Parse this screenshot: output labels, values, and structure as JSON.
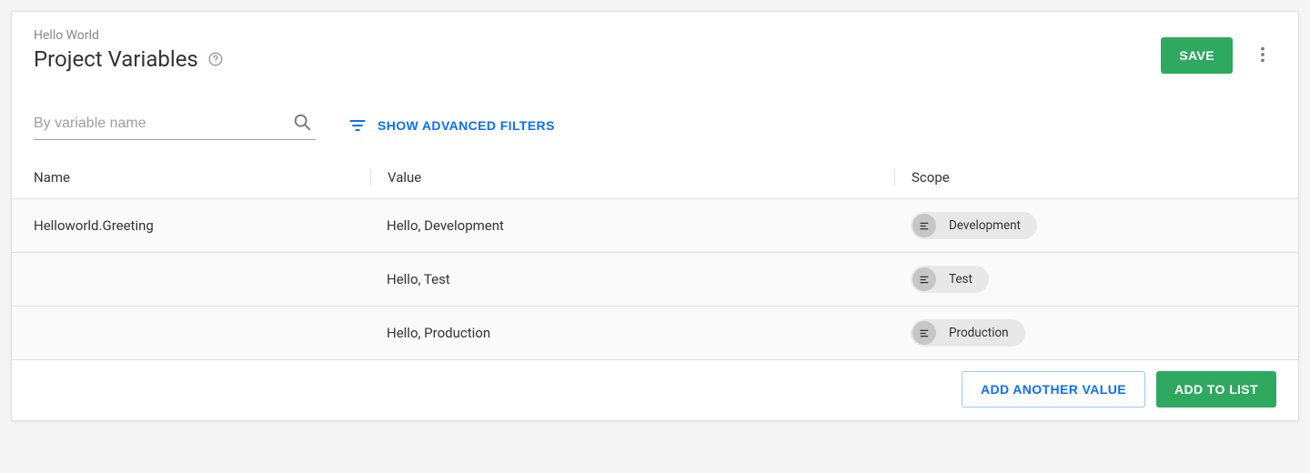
{
  "header": {
    "breadcrumb": "Hello World",
    "title": "Project Variables",
    "save_label": "SAVE"
  },
  "filters": {
    "search_placeholder": "By variable name",
    "advanced_label": "SHOW ADVANCED FILTERS"
  },
  "columns": {
    "name": "Name",
    "value": "Value",
    "scope": "Scope"
  },
  "rows": [
    {
      "name": "Helloworld.Greeting",
      "value": "Hello, Development",
      "scope": "Development"
    },
    {
      "name": "",
      "value": "Hello, Test",
      "scope": "Test"
    },
    {
      "name": "",
      "value": "Hello, Production",
      "scope": "Production"
    }
  ],
  "footer": {
    "add_another_label": "ADD ANOTHER VALUE",
    "add_to_list_label": "ADD TO LIST"
  },
  "colors": {
    "primary_green": "#2fa860",
    "link_blue": "#0d6efd"
  }
}
